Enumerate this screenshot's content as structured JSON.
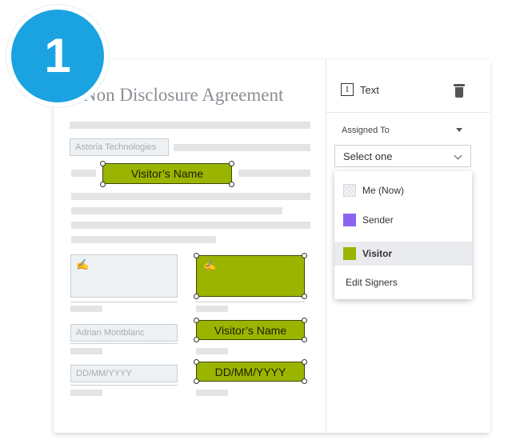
{
  "step_number": "1",
  "document": {
    "title": "Non Disclosure Agreement",
    "company_field_value": "Astoria Technologies",
    "visitor_name_label": "Visitor’s Name",
    "signer_name_value": "Adrian Montblanc",
    "date_placeholder": "DD/MM/YYYY",
    "date_field_label": "DD/MM/YYYY",
    "signature_icon": "signature-icon"
  },
  "panel": {
    "field_type": "Text",
    "assigned_to_label": "Assigned To",
    "select_value": "Select one",
    "options": [
      {
        "label": "Me (Now)",
        "swatch": "#e8eaed"
      },
      {
        "label": "Sender",
        "swatch": "#8a63f2"
      },
      {
        "label": "Visitor",
        "swatch": "#9bb400",
        "selected": true
      }
    ],
    "edit_signers_label": "Edit Signers"
  },
  "colors": {
    "badge": "#1aa3e0",
    "visitor_green": "#9bb400",
    "sender_purple": "#8a63f2"
  }
}
